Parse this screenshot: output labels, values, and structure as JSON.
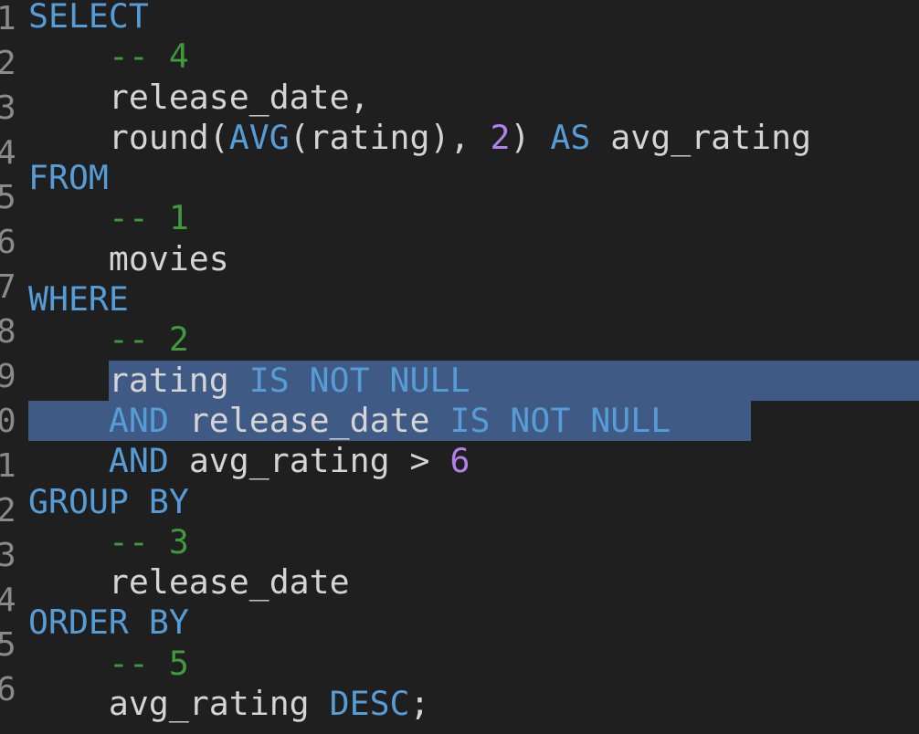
{
  "editor": {
    "line_numbers": [
      "1",
      "2",
      "3",
      "4",
      "5",
      "6",
      "7",
      "8",
      "9",
      "0",
      "1",
      "2",
      "3",
      "4",
      "5",
      "6"
    ],
    "colors": {
      "background": "#1f1f1f",
      "keyword": "#569cd6",
      "comment": "#3e9a3c",
      "number": "#b180ea",
      "text": "#d4d4d4",
      "selection": "#3f5b85"
    },
    "selection": {
      "from_line": 10,
      "from_col": 4,
      "to_line": 11,
      "to_col": 36
    },
    "lines": [
      [
        {
          "t": "SELECT",
          "c": "kw"
        }
      ],
      [
        {
          "t": "    ",
          "c": "tx"
        },
        {
          "t": "-- 4",
          "c": "cm"
        }
      ],
      [
        {
          "t": "    release_date,",
          "c": "tx"
        }
      ],
      [
        {
          "t": "    round(",
          "c": "tx"
        },
        {
          "t": "AVG",
          "c": "kw"
        },
        {
          "t": "(rating), ",
          "c": "tx"
        },
        {
          "t": "2",
          "c": "num"
        },
        {
          "t": ") ",
          "c": "tx"
        },
        {
          "t": "AS",
          "c": "kw"
        },
        {
          "t": " avg_rating",
          "c": "tx"
        }
      ],
      [
        {
          "t": "FROM",
          "c": "kw"
        }
      ],
      [
        {
          "t": "    ",
          "c": "tx"
        },
        {
          "t": "-- 1",
          "c": "cm"
        }
      ],
      [
        {
          "t": "    movies",
          "c": "tx"
        }
      ],
      [
        {
          "t": "WHERE",
          "c": "kw"
        }
      ],
      [
        {
          "t": "    ",
          "c": "tx"
        },
        {
          "t": "-- 2",
          "c": "cm"
        }
      ],
      [
        {
          "t": "    rating ",
          "c": "tx"
        },
        {
          "t": "IS NOT NULL",
          "c": "kw"
        }
      ],
      [
        {
          "t": "    ",
          "c": "tx"
        },
        {
          "t": "AND",
          "c": "kw"
        },
        {
          "t": " release_date ",
          "c": "tx"
        },
        {
          "t": "IS NOT NULL",
          "c": "kw"
        }
      ],
      [
        {
          "t": "    ",
          "c": "tx"
        },
        {
          "t": "AND",
          "c": "kw"
        },
        {
          "t": " avg_rating > ",
          "c": "tx"
        },
        {
          "t": "6",
          "c": "num"
        }
      ],
      [
        {
          "t": "GROUP BY",
          "c": "kw"
        }
      ],
      [
        {
          "t": "    ",
          "c": "tx"
        },
        {
          "t": "-- 3",
          "c": "cm"
        }
      ],
      [
        {
          "t": "    release_date",
          "c": "tx"
        }
      ],
      [
        {
          "t": "ORDER BY",
          "c": "kw"
        }
      ],
      [
        {
          "t": "    ",
          "c": "tx"
        },
        {
          "t": "-- 5",
          "c": "cm"
        }
      ],
      [
        {
          "t": "    avg_rating ",
          "c": "tx"
        },
        {
          "t": "DESC",
          "c": "kw"
        },
        {
          "t": ";",
          "c": "tx"
        }
      ]
    ]
  }
}
